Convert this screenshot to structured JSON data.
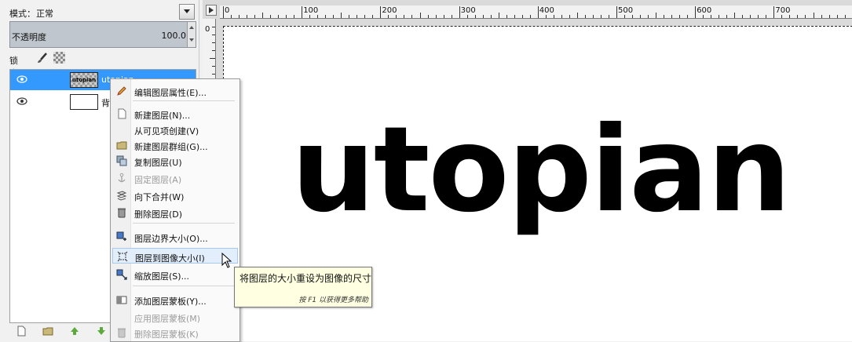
{
  "layers_panel": {
    "mode_label": "模式：",
    "mode_value": "正常",
    "opacity_label": "不透明度",
    "opacity_value": "100.0",
    "lock_label": "锁定：",
    "layers": [
      {
        "name": "utopian",
        "thumb_text": "utopian",
        "visible": true,
        "selected": true
      },
      {
        "name": "背景",
        "visible": true,
        "selected": false
      }
    ],
    "toolbar_icons": [
      "new-layer-icon",
      "new-group-icon",
      "raise-layer-icon",
      "lower-layer-icon"
    ]
  },
  "canvas": {
    "ruler_labels": [
      "0",
      "100",
      "200",
      "300",
      "400",
      "500",
      "600",
      "700"
    ],
    "vertical_ruler_label": "0",
    "text": "utopian"
  },
  "context_menu": {
    "items": [
      {
        "label": "编辑图层属性(E)...",
        "icon": "edit-layer-icon",
        "enabled": true
      },
      {
        "label": "新建图层(N)...",
        "icon": "new-layer-icon",
        "enabled": true
      },
      {
        "label": "从可见项创建(V)",
        "icon": "",
        "enabled": true
      },
      {
        "label": "新建图层群组(G)...",
        "icon": "folder-icon",
        "enabled": true
      },
      {
        "label": "复制图层(U)",
        "icon": "duplicate-icon",
        "enabled": true
      },
      {
        "label": "固定图层(A)",
        "icon": "anchor-icon",
        "enabled": false
      },
      {
        "label": "向下合并(W)",
        "icon": "merge-down-icon",
        "enabled": true
      },
      {
        "label": "删除图层(D)",
        "icon": "trash-icon",
        "enabled": true
      },
      {
        "label": "图层边界大小(O)...",
        "icon": "boundary-size-icon",
        "enabled": true
      },
      {
        "label": "图层到图像大小(I)",
        "icon": "layer-to-image-icon",
        "enabled": true,
        "hover": true
      },
      {
        "label": "缩放图层(S)...",
        "icon": "scale-layer-icon",
        "enabled": true
      },
      {
        "label": "添加图层蒙板(Y)...",
        "icon": "add-mask-icon",
        "enabled": true
      },
      {
        "label": "应用图层蒙板(M)",
        "icon": "",
        "enabled": false
      },
      {
        "label": "删除图层蒙板(K)",
        "icon": "trash-icon",
        "enabled": false
      }
    ]
  },
  "tooltip": {
    "text": "将图层的大小重设为图像的尺寸",
    "help": "按 F1 以获得更多帮助"
  },
  "colors": {
    "selection": "#3399ff",
    "tooltip_bg": "#ffffe1",
    "menu_hover": "#e3eefc"
  }
}
